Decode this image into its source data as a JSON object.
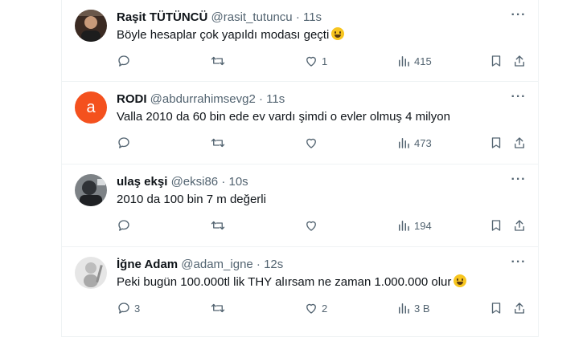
{
  "tweets": [
    {
      "name": "Raşit TÜTÜNCÜ",
      "handle": "@rasit_tutuncu",
      "dot": "·",
      "time": "11s",
      "text": "Böyle hesaplar çok yapıldı modası geçti",
      "has_emoji": true,
      "avatar": {
        "type": "photo",
        "color": "#4a3a30"
      },
      "replies": "",
      "retweets": "",
      "likes": "1",
      "views": "415"
    },
    {
      "name": "RODI",
      "handle": "@abdurrahimsevg2",
      "dot": "·",
      "time": "11s",
      "text": "Valla 2010 da 60 bin ede ev vardı şimdi o evler olmuş 4 milyon",
      "has_emoji": false,
      "avatar": {
        "type": "letter",
        "letter": "a",
        "color": "#f4511e"
      },
      "replies": "",
      "retweets": "",
      "likes": "",
      "views": "473"
    },
    {
      "name": "ulaş ekşi",
      "handle": "@eksi86",
      "dot": "·",
      "time": "10s",
      "text": "2010 da 100 bin 7 m değerli",
      "has_emoji": false,
      "avatar": {
        "type": "photo",
        "color": "#5b5f63"
      },
      "replies": "",
      "retweets": "",
      "likes": "",
      "views": "194"
    },
    {
      "name": "İğne Adam",
      "handle": "@adam_igne",
      "dot": "·",
      "time": "12s",
      "text": "Peki bugün 100.000tl lik THY alırsam ne zaman 1.000.000 olur",
      "has_emoji": true,
      "avatar": {
        "type": "photo",
        "color": "#c9c9c9"
      },
      "replies": "3",
      "retweets": "",
      "likes": "2",
      "views": "3 B"
    }
  ],
  "icons": {
    "reply": "reply-icon",
    "retweet": "retweet-icon",
    "like": "heart-icon",
    "views": "views-icon",
    "bookmark": "bookmark-icon",
    "share": "share-icon",
    "more": "more-icon"
  },
  "colors": {
    "text": "#0f1419",
    "secondary": "#536471",
    "border": "#eff3f4"
  }
}
